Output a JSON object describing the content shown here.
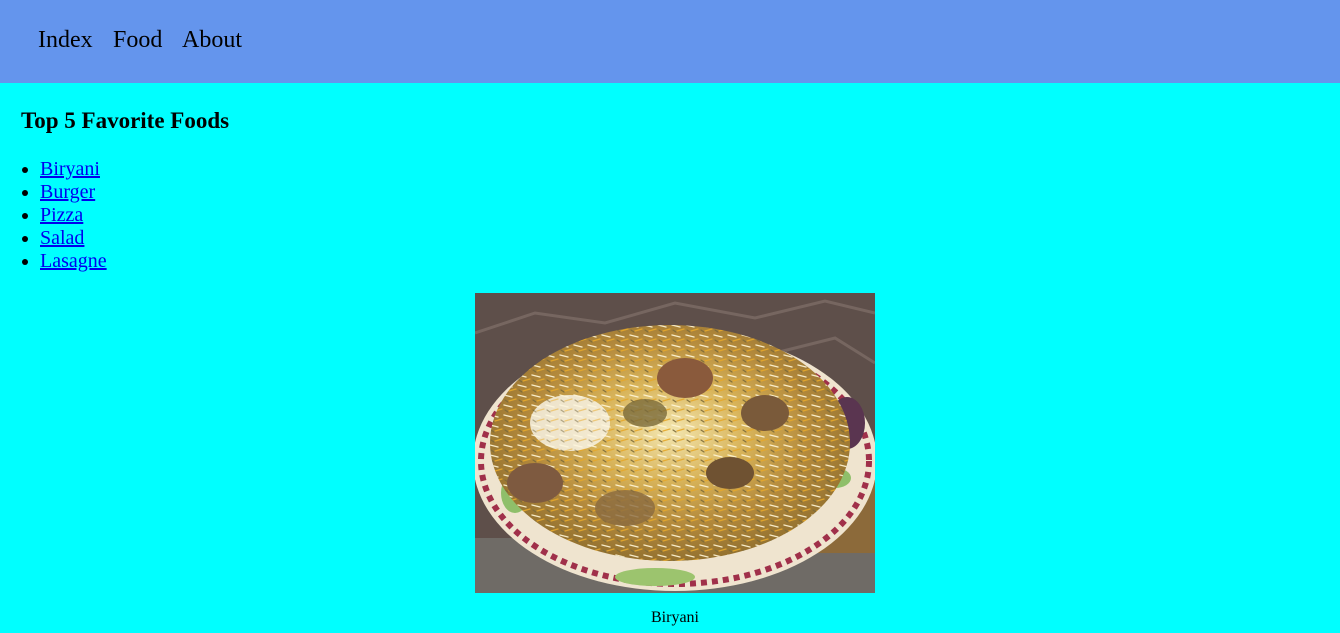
{
  "nav": {
    "items": [
      {
        "label": "Index"
      },
      {
        "label": "Food"
      },
      {
        "label": "About"
      }
    ]
  },
  "main": {
    "heading": "Top 5 Favorite Foods",
    "foods": [
      {
        "label": "Biryani"
      },
      {
        "label": "Burger"
      },
      {
        "label": "Pizza"
      },
      {
        "label": "Salad"
      },
      {
        "label": "Lasagne"
      }
    ],
    "image": {
      "alt": "Biryani",
      "caption": "Biryani"
    }
  },
  "colors": {
    "page_background": "#00ffff",
    "navbar_background": "#6495ed",
    "link": "#0000ee"
  }
}
